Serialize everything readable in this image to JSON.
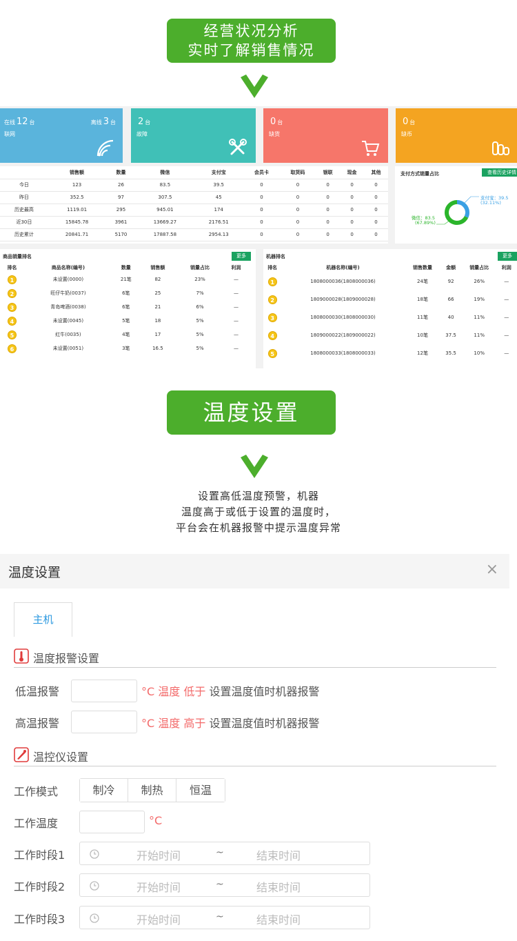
{
  "banner1": {
    "line1": "经营状况分析",
    "line2": "实时了解销售情况"
  },
  "banner2": {
    "text": "温度设置"
  },
  "dashboard": {
    "cards": [
      {
        "top_left_prefix": "在线",
        "top_left_value": "12",
        "top_left_unit": "台",
        "top_right_prefix": "离线",
        "top_right_value": "3",
        "top_right_unit": "台",
        "label": "联网",
        "color": "#5ab4dc",
        "icon": "wifi-icon"
      },
      {
        "value": "2",
        "unit": "台",
        "label": "故障",
        "color": "#40c0b7",
        "icon": "tools-icon"
      },
      {
        "value": "0",
        "unit": "台",
        "label": "缺货",
        "color": "#f6766a",
        "icon": "cart-icon"
      },
      {
        "value": "0",
        "unit": "台",
        "label": "缺币",
        "color": "#f4a421",
        "icon": "coins-icon"
      }
    ],
    "stats_table": {
      "headers": [
        "",
        "销售额",
        "数量",
        "微信",
        "支付宝",
        "会员卡",
        "取货码",
        "银联",
        "现金",
        "其他"
      ],
      "rows": [
        [
          "今日",
          "123",
          "26",
          "83.5",
          "39.5",
          "0",
          "0",
          "0",
          "0",
          "0"
        ],
        [
          "昨日",
          "352.5",
          "97",
          "307.5",
          "45",
          "0",
          "0",
          "0",
          "0",
          "0"
        ],
        [
          "历史最高",
          "1119.01",
          "295",
          "945.01",
          "174",
          "0",
          "0",
          "0",
          "0",
          "0"
        ],
        [
          "近30日",
          "15845.78",
          "3961",
          "13669.27",
          "2176.51",
          "0",
          "0",
          "0",
          "0",
          "0"
        ],
        [
          "历史累计",
          "20841.71",
          "5170",
          "17887.58",
          "2954.13",
          "0",
          "0",
          "0",
          "0",
          "0"
        ]
      ]
    },
    "pay_panel": {
      "title": "支付方式销量占比",
      "button": "查看历史详情",
      "alipay_label": "支付宝：39.5",
      "alipay_pct": "(32.11%)",
      "wechat_label": "微信：83.5",
      "wechat_pct": "(67.89%)",
      "wechat_color": "#2bb52b",
      "alipay_color": "#3aa0e4"
    },
    "goods_rank": {
      "title": "商品销量排名",
      "more": "更多",
      "headers": [
        "排名",
        "商品名称(编号)",
        "数量",
        "销售额",
        "销量占比",
        "利润"
      ],
      "rows": [
        [
          "1",
          "未设置(0000)",
          "21笔",
          "82",
          "23%",
          "—"
        ],
        [
          "2",
          "旺仔牛奶(0037)",
          "6笔",
          "25",
          "7%",
          "—"
        ],
        [
          "3",
          "青岛啤酒(0038)",
          "6笔",
          "21",
          "6%",
          "—"
        ],
        [
          "4",
          "未设置(0045)",
          "5笔",
          "18",
          "5%",
          "—"
        ],
        [
          "5",
          "红牛(0035)",
          "4笔",
          "17",
          "5%",
          "—"
        ],
        [
          "6",
          "未设置(0051)",
          "3笔",
          "16.5",
          "5%",
          "—"
        ]
      ]
    },
    "machine_rank": {
      "title": "机器排名",
      "more": "更多",
      "headers": [
        "排名",
        "机器名称(编号)",
        "销售数量",
        "金额",
        "销量占比",
        "利润"
      ],
      "rows": [
        [
          "1",
          "1808000036(1808000036)",
          "24笔",
          "92",
          "26%",
          "—"
        ],
        [
          "2",
          "1809000028(1809000028)",
          "18笔",
          "66",
          "19%",
          "—"
        ],
        [
          "3",
          "1808000030(1808000030)",
          "11笔",
          "40",
          "11%",
          "—"
        ],
        [
          "4",
          "1809000022(1809000022)",
          "10笔",
          "37.5",
          "11%",
          "—"
        ],
        [
          "5",
          "1808000033(1808000033)",
          "12笔",
          "35.5",
          "10%",
          "—"
        ]
      ]
    }
  },
  "description": {
    "line1": "设置高低温度预警，机器",
    "line2": "温度高于或低于设置的温度时，",
    "line3": "平台会在机器报警中提示温度异常"
  },
  "dialog": {
    "title": "温度设置",
    "close": "×",
    "tab": "主机",
    "alarm_section": "温度报警设置",
    "low_label": "低温报警",
    "low_unit_a": "°C 温度 ",
    "low_unit_b": "低于",
    "low_unit_c": " 设置温度值时机器报警",
    "high_label": "高温报警",
    "high_unit_a": "°C 温度 ",
    "high_unit_b": "高于",
    "high_unit_c": " 设置温度值时机器报警",
    "control_section": "温控仪设置",
    "mode_label": "工作模式",
    "modes": [
      "制冷",
      "制热",
      "恒温"
    ],
    "temp_label": "工作温度",
    "temp_unit": "°C",
    "periods": [
      {
        "label": "工作时段1",
        "start": "开始时间",
        "sep": "~",
        "end": "结束时间"
      },
      {
        "label": "工作时段2",
        "start": "开始时间",
        "sep": "~",
        "end": "结束时间"
      },
      {
        "label": "工作时段3",
        "start": "开始时间",
        "sep": "~",
        "end": "结束时间"
      }
    ]
  }
}
